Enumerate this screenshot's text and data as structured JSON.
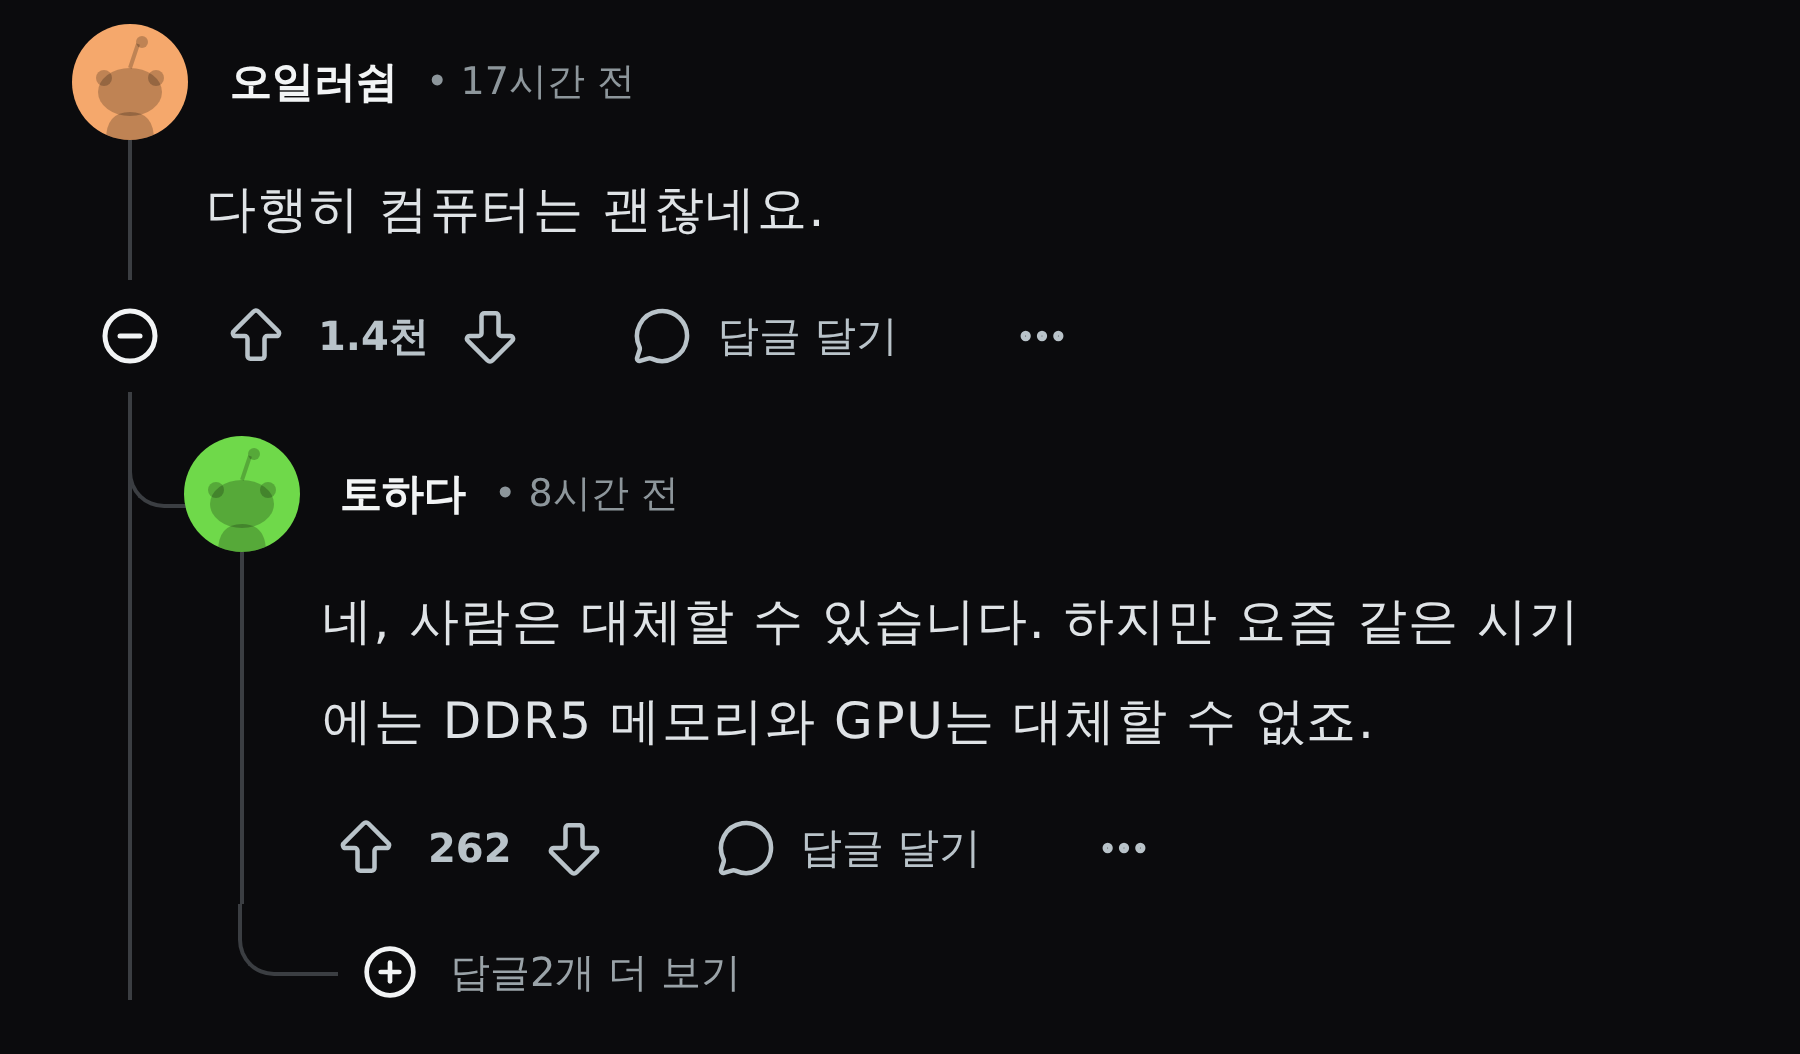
{
  "comments": [
    {
      "author": "오일러쉼",
      "time": "• 17시간 전",
      "color": "#f5a86c",
      "body": "다행히 컴퓨터는 괜찮네요.",
      "votes": "1.4천",
      "reply_label": "답글 달기",
      "expanded": true,
      "children": [
        {
          "author": "토하다",
          "time": "• 8시간 전",
          "color": "#6fd94a",
          "body": "네, 사람은 대체할 수 있습니다. 하지만 요즘 같은 시기 에는 DDR5 메모리와 GPU는 대체할 수 없죠.",
          "votes": "262",
          "reply_label": "답글 달기",
          "more_replies": "답글2개 더 보기"
        }
      ]
    }
  ]
}
